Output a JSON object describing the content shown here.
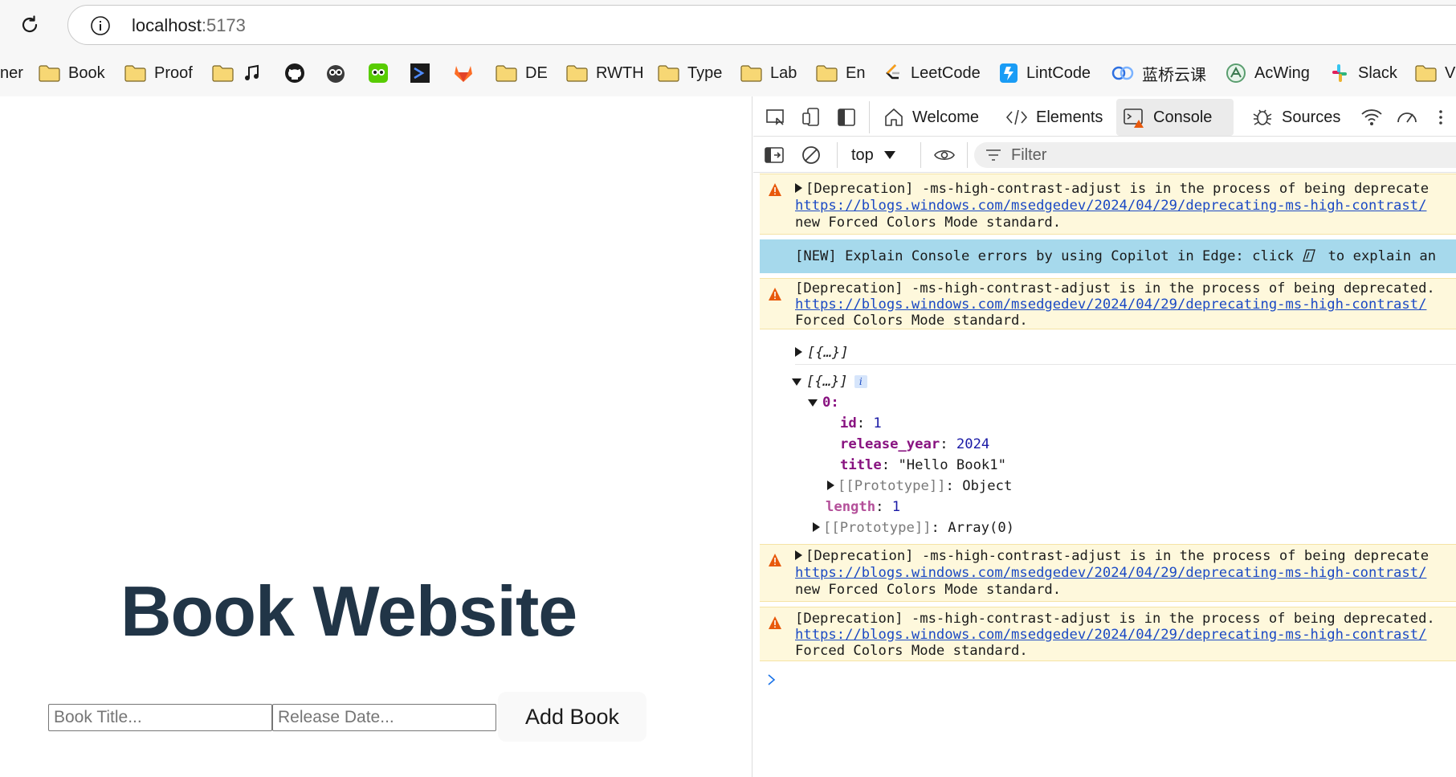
{
  "browser": {
    "url_host": "localhost",
    "url_port": ":5173",
    "bookmarks": [
      {
        "label": "ner",
        "icon": "partial-item",
        "kind": "text"
      },
      {
        "label": "Book",
        "icon": "folder-icon",
        "kind": "folder"
      },
      {
        "label": "Proof",
        "icon": "folder-icon",
        "kind": "folder"
      },
      {
        "label": "",
        "icon": "folder-icon",
        "kind": "folder"
      },
      {
        "label": "",
        "icon": "music-note-icon",
        "kind": "icon"
      },
      {
        "label": "",
        "icon": "github-icon",
        "kind": "icon"
      },
      {
        "label": "",
        "icon": "owl-icon",
        "kind": "icon"
      },
      {
        "label": "",
        "icon": "duolingo-icon",
        "kind": "icon"
      },
      {
        "label": "",
        "icon": "terminal-icon",
        "kind": "icon"
      },
      {
        "label": "",
        "icon": "gitlab-icon",
        "kind": "icon"
      },
      {
        "label": "DE",
        "icon": "folder-icon",
        "kind": "folder"
      },
      {
        "label": "RWTH",
        "icon": "folder-icon",
        "kind": "folder"
      },
      {
        "label": "Type",
        "icon": "folder-icon",
        "kind": "folder"
      },
      {
        "label": "Lab",
        "icon": "folder-icon",
        "kind": "folder"
      },
      {
        "label": "En",
        "icon": "folder-icon",
        "kind": "folder"
      },
      {
        "label": "LeetCode",
        "icon": "leetcode-icon",
        "kind": "site"
      },
      {
        "label": "LintCode",
        "icon": "lintcode-icon",
        "kind": "site"
      },
      {
        "label": "蓝桥云课",
        "icon": "lanqiao-icon",
        "kind": "site"
      },
      {
        "label": "AcWing",
        "icon": "acwing-icon",
        "kind": "site"
      },
      {
        "label": "Slack",
        "icon": "slack-icon",
        "kind": "site"
      },
      {
        "label": "V",
        "icon": "folder-icon",
        "kind": "folder"
      }
    ]
  },
  "page": {
    "title": "Book Website",
    "title_placeholder": "Book Title...",
    "date_placeholder": "Release Date...",
    "add_button": "Add Book"
  },
  "devtools": {
    "tabs": [
      {
        "label": "Welcome",
        "icon": "home-icon"
      },
      {
        "label": "Elements",
        "icon": "code-icon"
      },
      {
        "label": "Console",
        "icon": "console-icon",
        "active": true
      },
      {
        "label": "Sources",
        "icon": "bug-icon"
      }
    ],
    "context": "top",
    "filter_placeholder": "Filter",
    "console": {
      "warn1": {
        "line1": "[Deprecation] -ms-high-contrast-adjust is in the process of being deprecate",
        "link": "https://blogs.windows.com/msedgedev/2024/04/29/deprecating-ms-high-contrast/",
        "line3": "new Forced Colors Mode standard."
      },
      "info": {
        "before": "[NEW] Explain Console errors by using Copilot in Edge: click ",
        "after": " to explain an"
      },
      "warn2": {
        "line1": "[Deprecation] -ms-high-contrast-adjust is in the process of being deprecated.",
        "link": "https://blogs.windows.com/msedgedev/2024/04/29/deprecating-ms-high-contrast/",
        "line3": "Forced Colors Mode standard."
      },
      "collapsed_array": "[{…}]",
      "expanded_array": "[{…}]",
      "index_key": "0:",
      "fields": [
        {
          "key": "id",
          "value": "1",
          "type": "num"
        },
        {
          "key": "release_year",
          "value": "2024",
          "type": "num"
        },
        {
          "key": "title",
          "value": "\"Hello Book1\"",
          "type": "str"
        }
      ],
      "obj_proto_key": "[[Prototype]]",
      "obj_proto_val": "Object",
      "length_key": "length",
      "length_val": "1",
      "arr_proto_key": "[[Prototype]]",
      "arr_proto_val": "Array(0)",
      "warn3": {
        "line1": "[Deprecation] -ms-high-contrast-adjust is in the process of being deprecate",
        "link": "https://blogs.windows.com/msedgedev/2024/04/29/deprecating-ms-high-contrast/",
        "line3": "new Forced Colors Mode standard."
      },
      "warn4": {
        "line1": "[Deprecation] -ms-high-contrast-adjust is in the process of being deprecated.",
        "link": "https://blogs.windows.com/msedgedev/2024/04/29/deprecating-ms-high-contrast/",
        "line3": "Forced Colors Mode standard."
      }
    }
  },
  "colors": {
    "title": "#213547",
    "warn_bg": "#fef8dc",
    "info_bg": "#a6d9ec",
    "link": "#1a49c4"
  }
}
